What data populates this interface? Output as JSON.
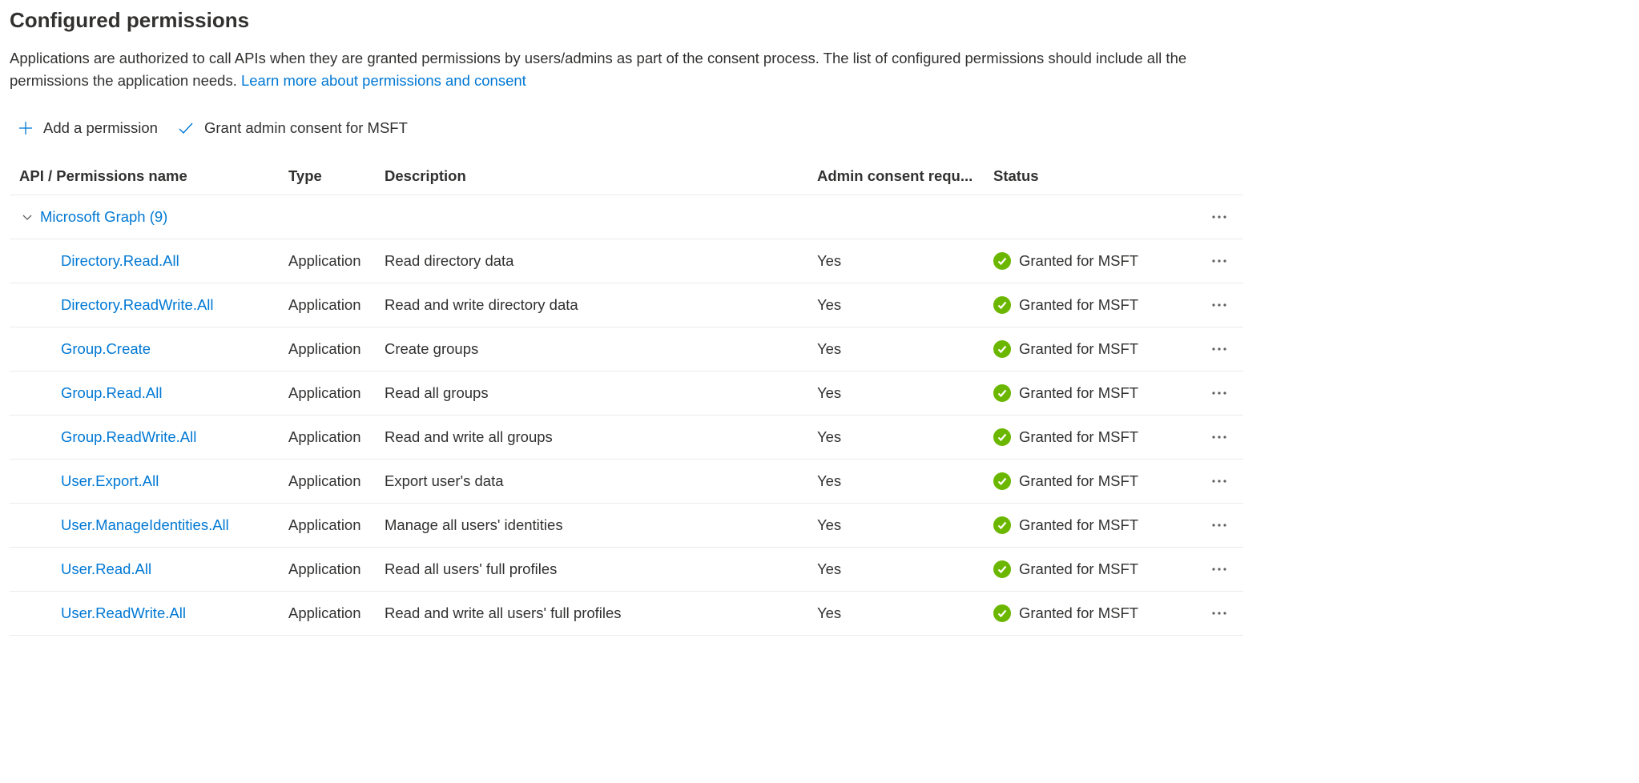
{
  "page": {
    "title": "Configured permissions",
    "description_pre": "Applications are authorized to call APIs when they are granted permissions by users/admins as part of the consent process. The list of configured permissions should include all the permissions the application needs. ",
    "description_link": "Learn more about permissions and consent"
  },
  "toolbar": {
    "add_permission": "Add a permission",
    "grant_consent": "Grant admin consent for MSFT"
  },
  "table": {
    "headers": {
      "api": "API / Permissions name",
      "type": "Type",
      "description": "Description",
      "admin_consent": "Admin consent requ...",
      "status": "Status"
    },
    "group": {
      "name": "Microsoft Graph (9)"
    },
    "rows": [
      {
        "name": "Directory.Read.All",
        "type": "Application",
        "description": "Read directory data",
        "admin": "Yes",
        "status": "Granted for MSFT"
      },
      {
        "name": "Directory.ReadWrite.All",
        "type": "Application",
        "description": "Read and write directory data",
        "admin": "Yes",
        "status": "Granted for MSFT"
      },
      {
        "name": "Group.Create",
        "type": "Application",
        "description": "Create groups",
        "admin": "Yes",
        "status": "Granted for MSFT"
      },
      {
        "name": "Group.Read.All",
        "type": "Application",
        "description": "Read all groups",
        "admin": "Yes",
        "status": "Granted for MSFT"
      },
      {
        "name": "Group.ReadWrite.All",
        "type": "Application",
        "description": "Read and write all groups",
        "admin": "Yes",
        "status": "Granted for MSFT"
      },
      {
        "name": "User.Export.All",
        "type": "Application",
        "description": "Export user's data",
        "admin": "Yes",
        "status": "Granted for MSFT"
      },
      {
        "name": "User.ManageIdentities.All",
        "type": "Application",
        "description": "Manage all users' identities",
        "admin": "Yes",
        "status": "Granted for MSFT"
      },
      {
        "name": "User.Read.All",
        "type": "Application",
        "description": "Read all users' full profiles",
        "admin": "Yes",
        "status": "Granted for MSFT"
      },
      {
        "name": "User.ReadWrite.All",
        "type": "Application",
        "description": "Read and write all users' full profiles",
        "admin": "Yes",
        "status": "Granted for MSFT"
      }
    ]
  }
}
